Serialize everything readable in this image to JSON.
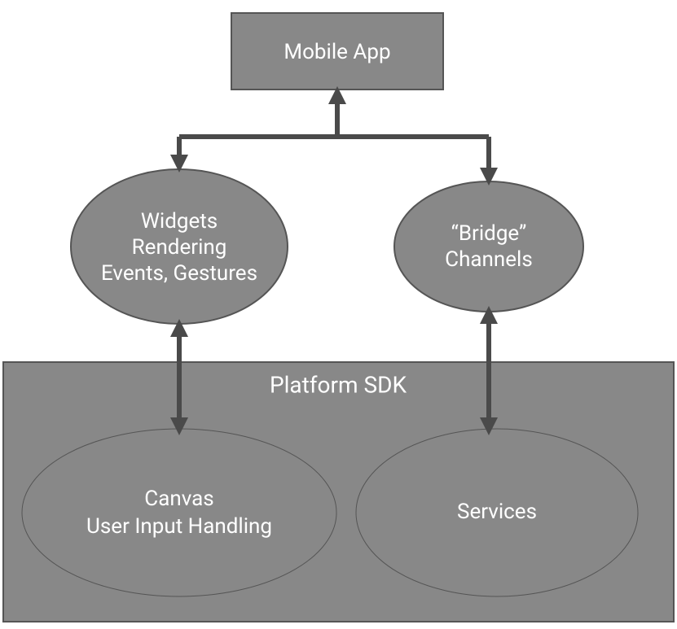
{
  "app": {
    "title": "Mobile App"
  },
  "widgets": {
    "line1": "Widgets",
    "line2": "Rendering",
    "line3": "Events, Gestures"
  },
  "bridge": {
    "line1": "“Bridge”",
    "line2": "Channels"
  },
  "sdk": {
    "title": "Platform SDK"
  },
  "canvas": {
    "line1": "Canvas",
    "line2": "User Input Handling"
  },
  "services": {
    "label": "Services"
  }
}
